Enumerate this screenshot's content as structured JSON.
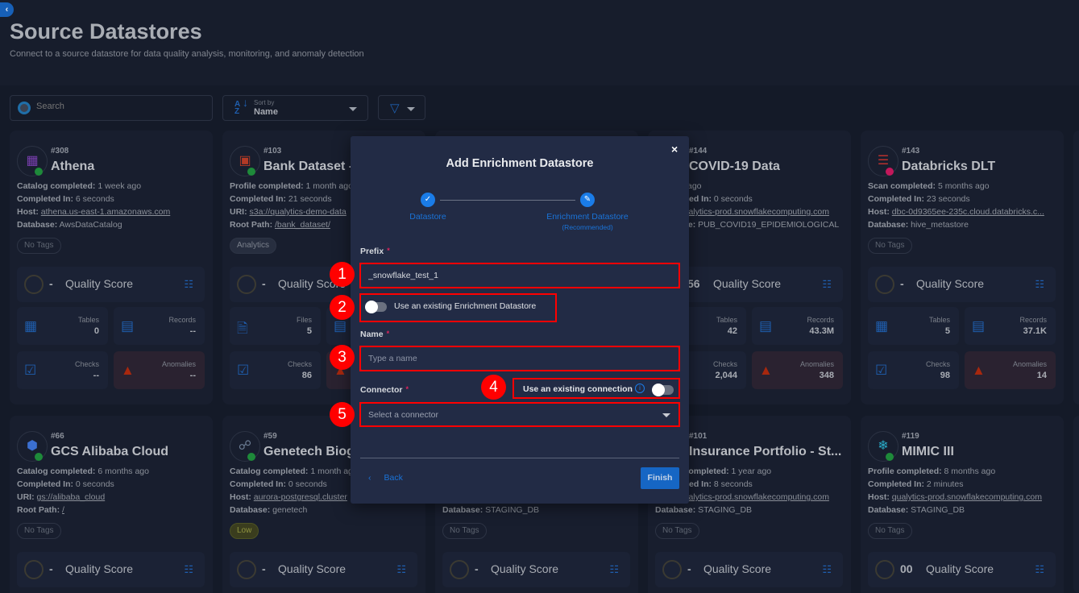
{
  "header": {
    "title": "Source Datastores",
    "subtitle": "Connect to a source datastore for data quality analysis, monitoring, and anomaly detection",
    "collapse_icon": "chevron-left-icon"
  },
  "toolbar": {
    "search_placeholder": "Search",
    "sort_label": "Sort by",
    "sort_value": "Name",
    "filter_icon": "filter-icon"
  },
  "colors": {
    "accent": "#1a7ce8",
    "annotation": "#ff0000",
    "status_ok": "#1e8a3a",
    "status_error": "#c2185b",
    "anomaly": "#a8280e"
  },
  "cards": [
    {
      "id": "#308",
      "name": "Athena",
      "icon": "athena",
      "status": "ok",
      "lines": [
        {
          "label": "Catalog completed:",
          "value": "1 week ago"
        },
        {
          "label": "Completed In:",
          "value": "6 seconds"
        },
        {
          "label": "Host:",
          "value": "athena.us-east-1.amazonaws.com",
          "link": true
        },
        {
          "label": "Database:",
          "value": "AwsDataCatalog"
        }
      ],
      "tag": "No Tags",
      "score": "-",
      "score_label": "Quality Score",
      "stats": [
        {
          "label": "Tables",
          "value": "0",
          "icon": "table-icon"
        },
        {
          "label": "Records",
          "value": "--",
          "icon": "records-icon"
        },
        {
          "label": "Checks",
          "value": "--",
          "icon": "checks-icon"
        },
        {
          "label": "Anomalies",
          "value": "--",
          "icon": "warning-icon"
        }
      ]
    },
    {
      "id": "#103",
      "name": "Bank Dataset - ",
      "icon": "s3",
      "status": "ok",
      "lines": [
        {
          "label": "Profile completed:",
          "value": "1 month ago"
        },
        {
          "label": "Completed In:",
          "value": "21 seconds"
        },
        {
          "label": "URI:",
          "value": "s3a://qualytics-demo-data",
          "link": true
        },
        {
          "label": "Root Path:",
          "value": "/bank_dataset/",
          "link": true
        }
      ],
      "tag": "Analytics",
      "score": "-",
      "score_label": "Quality Score",
      "stats": [
        {
          "label": "Files",
          "value": "5",
          "icon": "file-icon"
        },
        {
          "label": "",
          "value": "",
          "icon": "records-icon"
        },
        {
          "label": "Checks",
          "value": "86",
          "icon": "checks-icon"
        },
        {
          "label": "",
          "value": "",
          "icon": "warning-icon"
        }
      ]
    },
    {
      "id": "",
      "name": "",
      "icon": "",
      "status": "",
      "lines": [],
      "tag": "",
      "score": "",
      "score_label": "",
      "stats": []
    },
    {
      "id": "#144",
      "name": "COVID-19 Data",
      "icon": "snowflake",
      "status": "ok",
      "lines": [
        {
          "label": "",
          "value": "ago"
        },
        {
          "label": "Completed In:",
          "value": "0 seconds"
        },
        {
          "label": "Host:",
          "value": "qualytics-prod.snowflakecomputing.com",
          "link": true
        },
        {
          "label": "Database:",
          "value": "PUB_COVID19_EPIDEMIOLOGICAL"
        }
      ],
      "tag": "",
      "score": "56",
      "score_label": "Quality Score",
      "stats": [
        {
          "label": "Tables",
          "value": "42",
          "icon": "table-icon"
        },
        {
          "label": "Records",
          "value": "43.3M",
          "icon": "records-icon"
        },
        {
          "label": "Checks",
          "value": "2,044",
          "icon": "checks-icon"
        },
        {
          "label": "Anomalies",
          "value": "348",
          "icon": "warning-icon"
        }
      ]
    },
    {
      "id": "#143",
      "name": "Databricks DLT",
      "icon": "databricks",
      "status": "error",
      "lines": [
        {
          "label": "Scan completed:",
          "value": "5 months ago"
        },
        {
          "label": "Completed In:",
          "value": "23 seconds"
        },
        {
          "label": "Host:",
          "value": "dbc-0d9365ee-235c.cloud.databricks.c...",
          "link": true
        },
        {
          "label": "Database:",
          "value": "hive_metastore"
        }
      ],
      "tag": "No Tags",
      "score": "-",
      "score_label": "Quality Score",
      "stats": [
        {
          "label": "Tables",
          "value": "5",
          "icon": "table-icon"
        },
        {
          "label": "Records",
          "value": "37.1K",
          "icon": "records-icon"
        },
        {
          "label": "Checks",
          "value": "98",
          "icon": "checks-icon"
        },
        {
          "label": "Anomalies",
          "value": "14",
          "icon": "warning-icon"
        }
      ]
    },
    {
      "id": "#66",
      "name": "GCS Alibaba Cloud",
      "icon": "gcs",
      "status": "ok",
      "lines": [
        {
          "label": "Catalog completed:",
          "value": "6 months ago"
        },
        {
          "label": "Completed In:",
          "value": "0 seconds"
        },
        {
          "label": "URI:",
          "value": "gs://alibaba_cloud",
          "link": true
        },
        {
          "label": "Root Path:",
          "value": "/",
          "link": true
        }
      ],
      "tag": "No Tags",
      "score": "-",
      "score_label": "Quality Score",
      "stats": []
    },
    {
      "id": "#59",
      "name": "Genetech Biog",
      "icon": "postgresql",
      "status": "ok",
      "lines": [
        {
          "label": "Catalog completed:",
          "value": "1 month ago"
        },
        {
          "label": "Completed In:",
          "value": "0 seconds"
        },
        {
          "label": "Host:",
          "value": "aurora-postgresql.cluster",
          "link": true
        },
        {
          "label": "Database:",
          "value": "genetech"
        }
      ],
      "tag": "Low",
      "score": "-",
      "score_label": "Quality Score",
      "stats": []
    },
    {
      "id": "",
      "name": "",
      "icon": "",
      "status": "",
      "lines": [
        {
          "label": "",
          "value": ""
        },
        {
          "label": "",
          "value": ""
        },
        {
          "label": "",
          "value": ""
        },
        {
          "label": "Database:",
          "value": "STAGING_DB"
        }
      ],
      "tag": "No Tags",
      "score": "-",
      "score_label": "Quality Score",
      "stats": []
    },
    {
      "id": "#101",
      "name": "Insurance Portfolio - St...",
      "icon": "snowflake",
      "status": "ok",
      "lines": [
        {
          "label": "Profile completed:",
          "value": "1 year ago"
        },
        {
          "label": "Completed In:",
          "value": "8 seconds"
        },
        {
          "label": "Host:",
          "value": "qualytics-prod.snowflakecomputing.com",
          "link": true
        },
        {
          "label": "Database:",
          "value": "STAGING_DB"
        }
      ],
      "tag": "No Tags",
      "score": "-",
      "score_label": "Quality Score",
      "stats": []
    },
    {
      "id": "#119",
      "name": "MIMIC III",
      "icon": "snowflake",
      "status": "ok",
      "lines": [
        {
          "label": "Profile completed:",
          "value": "8 months ago"
        },
        {
          "label": "Completed In:",
          "value": "2 minutes"
        },
        {
          "label": "Host:",
          "value": "qualytics-prod.snowflakecomputing.com",
          "link": true
        },
        {
          "label": "Database:",
          "value": "STAGING_DB"
        }
      ],
      "tag": "No Tags",
      "score": "00",
      "score_label": "Quality Score",
      "stats": []
    }
  ],
  "modal": {
    "title": "Add Enrichment Datastore",
    "steps": [
      {
        "label": "Datastore",
        "state": "done"
      },
      {
        "label": "Enrichment Datastore",
        "sub": "(Recommended)",
        "state": "active"
      }
    ],
    "prefix_label": "Prefix",
    "prefix_value": "_snowflake_test_1",
    "existing_enrichment_label": "Use an existing Enrichment Datastore",
    "existing_enrichment_on": false,
    "name_label": "Name",
    "name_placeholder": "Type a name",
    "connector_label": "Connector",
    "existing_connection_label": "Use an existing connection",
    "existing_connection_on": false,
    "connector_placeholder": "Select a connector",
    "back_label": "Back",
    "finish_label": "Finish",
    "required_mark": "*",
    "close_label": "×"
  },
  "annotations": [
    "1",
    "2",
    "3",
    "4",
    "5"
  ]
}
